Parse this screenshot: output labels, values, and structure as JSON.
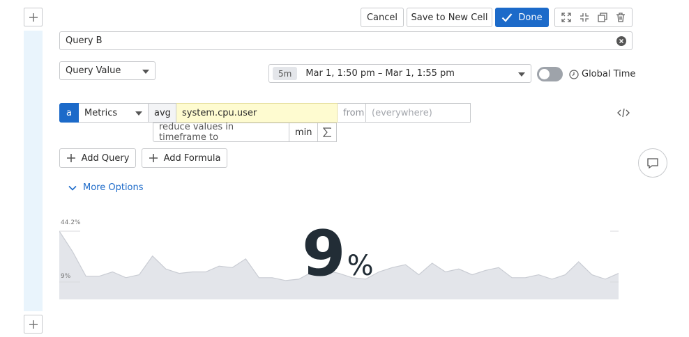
{
  "toolbar": {
    "cancel_label": "Cancel",
    "save_new_cell_label": "Save to New Cell",
    "done_label": "Done"
  },
  "cell": {
    "title_value": "Query B"
  },
  "visualization": {
    "type_selected": "Query Value"
  },
  "timeframe": {
    "badge": "5m",
    "range": "Mar 1, 1:50 pm – Mar 1, 1:55 pm",
    "global_time_label": "Global Time",
    "global_time_enabled": false
  },
  "query": {
    "letter": "a",
    "source": "Metrics",
    "aggregation": "avg",
    "metric": "system.cpu.user",
    "from_label": "from",
    "from_placeholder": "(everywhere)",
    "reduce_label": "reduce values in timeframe to",
    "reduce_value": "min"
  },
  "actions": {
    "add_query_label": "Add Query",
    "add_formula_label": "Add Formula",
    "more_options_label": "More Options"
  },
  "preview": {
    "value": "9",
    "unit": "%",
    "max_label": "44.2%",
    "min_label": "9%",
    "sparkline": [
      44.2,
      30,
      13,
      13,
      16,
      12,
      14,
      27,
      18,
      15,
      16,
      16,
      20,
      19,
      25,
      12,
      12,
      10,
      11,
      16,
      17,
      15,
      12,
      11,
      16,
      19,
      21,
      14,
      22,
      16,
      18,
      14,
      17,
      19,
      12,
      12,
      14,
      11,
      14,
      23,
      14,
      11,
      15
    ]
  },
  "colors": {
    "accent": "#1c6ac9",
    "metric_highlight": "#fefbd0",
    "sparkline_fill": "#e3e5ea",
    "sparkline_stroke": "#c9ccd3"
  }
}
